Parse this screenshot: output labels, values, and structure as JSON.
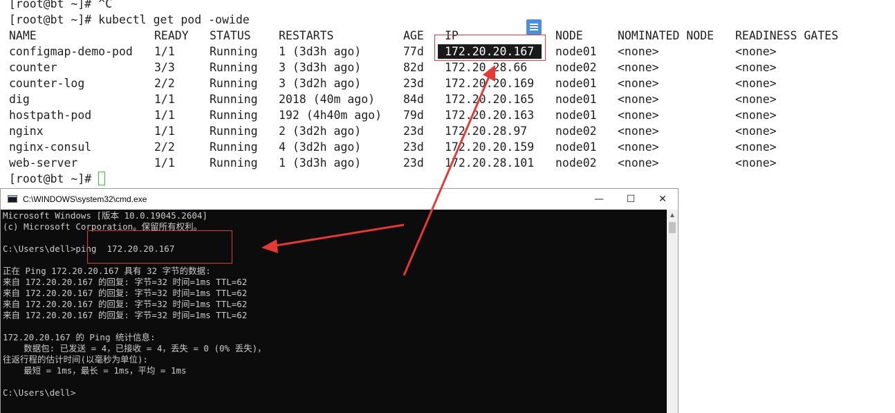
{
  "terminal": {
    "lines": {
      "l0": "[root@bt ~]# ^C",
      "l1": "[root@bt ~]# kubectl get pod -owide",
      "prompt": "[root@bt ~]# "
    },
    "headers": [
      "NAME",
      "READY",
      "STATUS",
      "RESTARTS",
      "AGE",
      "IP",
      "NODE",
      "NOMINATED NODE",
      "READINESS GATES"
    ],
    "rows": [
      [
        "configmap-demo-pod",
        "1/1",
        "Running",
        "1 (3d3h ago)",
        "77d",
        "172.20.20.167",
        "node01",
        "<none>",
        "<none>"
      ],
      [
        "counter",
        "3/3",
        "Running",
        "3 (3d3h ago)",
        "82d",
        "172.20.28.66",
        "node02",
        "<none>",
        "<none>"
      ],
      [
        "counter-log",
        "2/2",
        "Running",
        "3 (3d2h ago)",
        "23d",
        "172.20.20.169",
        "node01",
        "<none>",
        "<none>"
      ],
      [
        "dig",
        "1/1",
        "Running",
        "2018 (40m ago)",
        "84d",
        "172.20.20.165",
        "node01",
        "<none>",
        "<none>"
      ],
      [
        "hostpath-pod",
        "1/1",
        "Running",
        "192 (4h40m ago)",
        "79d",
        "172.20.20.163",
        "node01",
        "<none>",
        "<none>"
      ],
      [
        "nginx",
        "1/1",
        "Running",
        "2 (3d2h ago)",
        "23d",
        "172.20.28.97",
        "node02",
        "<none>",
        "<none>"
      ],
      [
        "nginx-consul",
        "2/2",
        "Running",
        "4 (3d2h ago)",
        "23d",
        "172.20.20.159",
        "node01",
        "<none>",
        "<none>"
      ],
      [
        "web-server",
        "1/1",
        "Running",
        "1 (3d3h ago)",
        "23d",
        "172.20.28.101",
        "node02",
        "<none>",
        "<none>"
      ]
    ]
  },
  "cmd_window": {
    "title": "C:\\WINDOWS\\system32\\cmd.exe",
    "minimize": "—",
    "maximize": "☐",
    "close": "✕",
    "console_lines": [
      "Microsoft Windows [版本 10.0.19045.2604]",
      "(c) Microsoft Corporation。保留所有权利。",
      "",
      "C:\\Users\\dell>ping  172.20.20.167",
      "",
      "正在 Ping 172.20.20.167 具有 32 字节的数据:",
      "来自 172.20.20.167 的回复: 字节=32 时间=1ms TTL=62",
      "来自 172.20.20.167 的回复: 字节=32 时间=1ms TTL=62",
      "来自 172.20.20.167 的回复: 字节=32 时间=1ms TTL=62",
      "来自 172.20.20.167 的回复: 字节=32 时间=1ms TTL=62",
      "",
      "172.20.20.167 的 Ping 统计信息:",
      "    数据包: 已发送 = 4，已接收 = 4，丢失 = 0 (0% 丢失)，",
      "往返行程的估计时间(以毫秒为单位):",
      "    最短 = 1ms，最长 = 1ms，平均 = 1ms",
      "",
      "C:\\Users\\dell>"
    ]
  },
  "colors": {
    "annotation_red": "#e53935",
    "cursor_green": "#39c239",
    "console_bg": "#0c0c0c"
  }
}
